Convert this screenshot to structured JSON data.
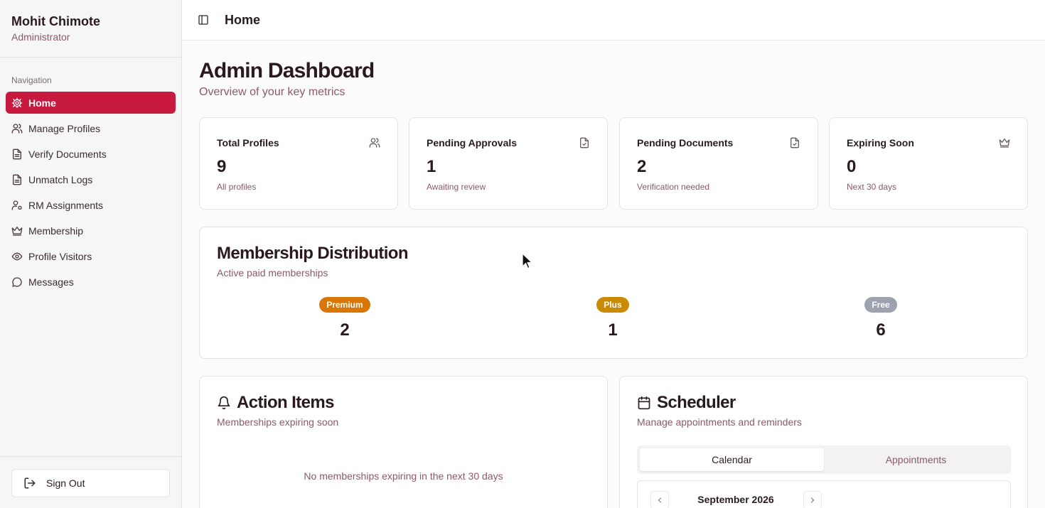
{
  "user": {
    "name": "Mohit Chimote",
    "role": "Administrator"
  },
  "sidebar": {
    "heading": "Navigation",
    "items": [
      {
        "label": "Home",
        "icon": "gear-icon",
        "active": true
      },
      {
        "label": "Manage Profiles",
        "icon": "users-icon"
      },
      {
        "label": "Verify Documents",
        "icon": "document-icon"
      },
      {
        "label": "Unmatch Logs",
        "icon": "document-icon"
      },
      {
        "label": "RM Assignments",
        "icon": "user-cog-icon"
      },
      {
        "label": "Membership",
        "icon": "crown-icon"
      },
      {
        "label": "Profile Visitors",
        "icon": "eye-icon"
      },
      {
        "label": "Messages",
        "icon": "message-icon"
      }
    ],
    "signout": "Sign Out"
  },
  "header": {
    "title": "Home"
  },
  "main": {
    "title": "Admin Dashboard",
    "subtitle": "Overview of your key metrics",
    "stats": [
      {
        "label": "Total Profiles",
        "value": "9",
        "note": "All profiles",
        "icon": "users-icon"
      },
      {
        "label": "Pending Approvals",
        "value": "1",
        "note": "Awaiting review",
        "icon": "file-check-icon"
      },
      {
        "label": "Pending Documents",
        "value": "2",
        "note": "Verification needed",
        "icon": "file-check-icon"
      },
      {
        "label": "Expiring Soon",
        "value": "0",
        "note": "Next 30 days",
        "icon": "crown-icon"
      }
    ],
    "distribution": {
      "title": "Membership Distribution",
      "subtitle": "Active paid memberships",
      "tiers": [
        {
          "label": "Premium",
          "count": "2",
          "color": "#d97706"
        },
        {
          "label": "Plus",
          "count": "1",
          "color": "#ca8a04"
        },
        {
          "label": "Free",
          "count": "6",
          "color": "#9ca3af"
        }
      ]
    },
    "action_items": {
      "title": "Action Items",
      "subtitle": "Memberships expiring soon",
      "empty": "No memberships expiring in the next 30 days"
    },
    "scheduler": {
      "title": "Scheduler",
      "subtitle": "Manage appointments and reminders",
      "tabs": [
        "Calendar",
        "Appointments"
      ],
      "month": "September 2026"
    }
  },
  "colors": {
    "accent": "#c8193f",
    "muted_text": "#8a5a68"
  }
}
